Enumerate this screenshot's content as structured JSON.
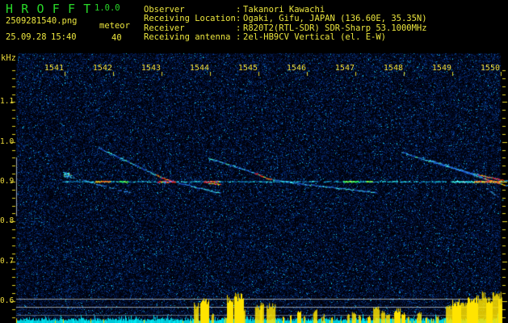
{
  "app": {
    "title": "H R O F F T",
    "version": "1.0.0"
  },
  "session": {
    "filename": "2509281540.png",
    "mode": "meteor",
    "date": "25.09.28",
    "time": "15:40",
    "count": "40"
  },
  "receiver_info": {
    "separator": ":",
    "rows": [
      {
        "label": "Observer",
        "value": "Takanori Kawachi"
      },
      {
        "label": "Receiving Location",
        "value": "Ogaki, Gifu, JAPAN (136.60E, 35.35N)"
      },
      {
        "label": "Receiver",
        "value": "R820T2(RTL-SDR) SDR-Sharp 53.1000MHz"
      },
      {
        "label": "Receiving antenna",
        "value": "2el-HB9CV Vertical (el. E-W)"
      }
    ]
  },
  "chart_data": {
    "type": "heatmap",
    "title": "HROFFT 10-minute radio meteor echo spectrogram",
    "y_unit": "kHz",
    "x_ticks": [
      "1541",
      "1542",
      "1543",
      "1544",
      "1545",
      "1546",
      "1547",
      "1548",
      "1549",
      "1550"
    ],
    "x_range_time": [
      "15:40",
      "15:50"
    ],
    "y_ticks": [
      "1.1",
      "1.0",
      "0.9",
      "0.8",
      "0.7",
      "0.6"
    ],
    "y_tick_values": [
      1.1,
      1.0,
      0.9,
      0.8,
      0.7,
      0.6
    ],
    "y_range_khz": [
      0.553,
      1.223
    ],
    "grid": false,
    "legend": false,
    "marker_band_khz": [
      0.814,
      0.961
    ],
    "ref_line_count": 3,
    "carrier": {
      "f_khz": 0.9,
      "t_start": 0.95,
      "t_end": 10.0,
      "bright_segments": [
        {
          "t": 1.63,
          "dt": 0.3,
          "c": "red"
        },
        {
          "t": 2.13,
          "dt": 0.18,
          "c": "green"
        },
        {
          "t": 2.92,
          "dt": 0.35,
          "c": "hot"
        },
        {
          "t": 3.87,
          "dt": 0.33,
          "c": "hot"
        },
        {
          "t": 6.75,
          "dt": 0.3,
          "c": "green"
        },
        {
          "t": 7.22,
          "dt": 0.12,
          "c": "green"
        },
        {
          "t": 9.0,
          "dt": 1.02,
          "c": "brightcyan"
        },
        {
          "t": 9.45,
          "dt": 0.55,
          "c": "red"
        }
      ]
    },
    "echo_traces": [
      {
        "kind": "blob",
        "t": 1.03,
        "f": 0.918
      },
      {
        "kind": "faint",
        "points": [
          [
            1.0,
            0.916
          ],
          [
            2.42,
            0.87
          ]
        ],
        "hot": []
      },
      {
        "kind": "chirp",
        "points": [
          [
            1.7,
            0.985
          ],
          [
            2.47,
            0.941
          ],
          [
            3.08,
            0.906
          ],
          [
            3.67,
            0.888
          ],
          [
            4.2,
            0.872
          ]
        ],
        "hot": [
          [
            2.88,
            3.3
          ]
        ]
      },
      {
        "kind": "chirp",
        "points": [
          [
            3.97,
            0.959
          ],
          [
            4.5,
            0.939
          ],
          [
            4.97,
            0.92
          ],
          [
            5.2,
            0.908
          ],
          [
            5.83,
            0.896
          ],
          [
            6.67,
            0.884
          ],
          [
            7.42,
            0.874
          ]
        ],
        "hot": [
          [
            4.92,
            5.25
          ]
        ]
      },
      {
        "kind": "dash",
        "points": [
          [
            3.97,
            0.896
          ],
          [
            4.22,
            0.894
          ]
        ],
        "hot": [
          [
            3.95,
            4.25
          ]
        ]
      },
      {
        "kind": "chirp",
        "points": [
          [
            7.95,
            0.975
          ],
          [
            8.5,
            0.953
          ],
          [
            9.08,
            0.932
          ],
          [
            9.67,
            0.914
          ],
          [
            10.13,
            0.902
          ]
        ],
        "hot": [
          [
            9.53,
            10.05
          ]
        ]
      },
      {
        "kind": "chirp",
        "points": [
          [
            8.53,
            0.955
          ],
          [
            9.17,
            0.928
          ],
          [
            9.67,
            0.908
          ],
          [
            10.13,
            0.89
          ]
        ],
        "hot": [
          [
            9.63,
            10.08
          ]
        ]
      },
      {
        "kind": "faint",
        "points": [
          [
            8.83,
            0.945
          ],
          [
            9.83,
            0.902
          ]
        ],
        "hot": []
      },
      {
        "kind": "faint",
        "points": [
          [
            9.55,
            0.898
          ],
          [
            10.03,
            0.853
          ]
        ],
        "hot": []
      }
    ],
    "activity_spikes": [
      [
        3.67,
        0.1,
        0.49
      ],
      [
        3.8,
        0.17,
        0.62
      ],
      [
        4.03,
        0.05,
        0.22
      ],
      [
        4.35,
        0.13,
        0.67
      ],
      [
        4.5,
        0.2,
        0.73
      ],
      [
        4.68,
        0.05,
        0.4
      ],
      [
        4.93,
        0.15,
        0.44
      ],
      [
        5.03,
        0.07,
        0.58
      ],
      [
        5.17,
        0.17,
        0.49
      ],
      [
        5.5,
        0.03,
        0.18
      ],
      [
        5.65,
        0.02,
        0.2
      ],
      [
        5.8,
        0.07,
        0.31
      ],
      [
        5.93,
        0.02,
        0.18
      ],
      [
        6.13,
        0.07,
        0.33
      ],
      [
        6.33,
        0.03,
        0.22
      ],
      [
        6.5,
        0.02,
        0.16
      ],
      [
        6.83,
        0.05,
        0.22
      ],
      [
        6.93,
        0.07,
        0.27
      ],
      [
        7.07,
        0.02,
        0.2
      ],
      [
        7.25,
        0.05,
        0.18
      ],
      [
        7.37,
        0.13,
        0.4
      ],
      [
        7.53,
        0.08,
        0.31
      ],
      [
        7.63,
        0.07,
        0.22
      ],
      [
        7.8,
        0.13,
        0.36
      ],
      [
        7.95,
        0.07,
        0.27
      ],
      [
        8.08,
        0.02,
        0.18
      ],
      [
        8.28,
        0.08,
        0.27
      ],
      [
        8.45,
        0.02,
        0.16
      ],
      [
        8.67,
        0.05,
        0.18
      ],
      [
        8.87,
        0.13,
        0.44
      ],
      [
        9.0,
        0.17,
        0.58
      ],
      [
        9.17,
        0.13,
        0.49
      ],
      [
        9.3,
        0.23,
        0.67
      ],
      [
        9.53,
        0.17,
        0.76
      ],
      [
        9.7,
        0.13,
        0.62
      ],
      [
        9.83,
        0.2,
        0.8
      ],
      [
        9.95,
        0.08,
        0.62
      ]
    ]
  },
  "colors": {
    "background": "#000000",
    "title_green": "#29d829",
    "text_yellow": "#ece63e",
    "axis_yellow": "#e3d428",
    "noise_blue": "#2233bb",
    "carrier_cyan": "#33ddee",
    "hot_red": "#ff2a18",
    "activity_yellow": "#ffe400",
    "activity_cyan": "#00c8d8",
    "ref_gray": "#a0aab0"
  }
}
